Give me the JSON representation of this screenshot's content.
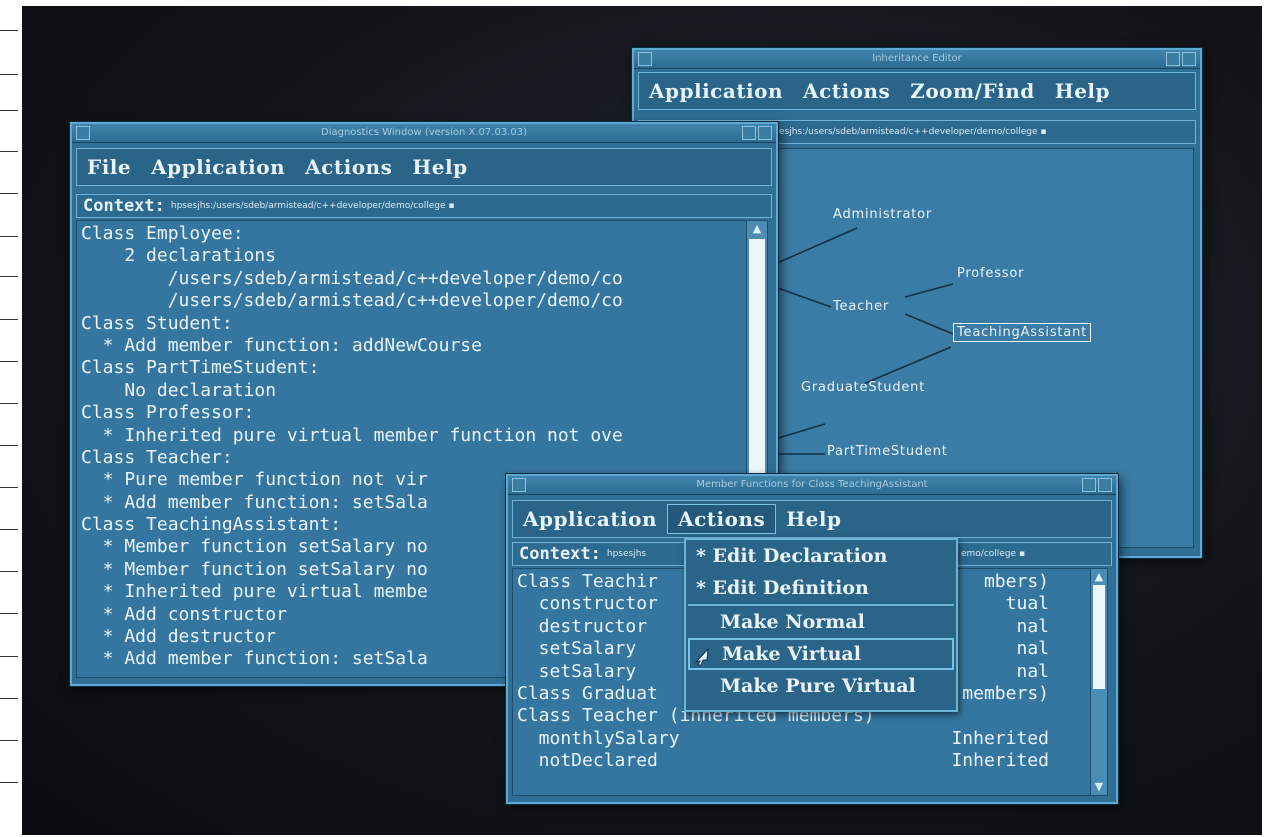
{
  "diagnostics": {
    "title": "Diagnostics Window (version X.07.03.03)",
    "menu": [
      "File",
      "Application",
      "Actions",
      "Help"
    ],
    "context_label": "Context:",
    "context_path": "hpsesjhs:/users/sdeb/armistead/c++developer/demo/college ▪",
    "lines": [
      "Class Employee:",
      "    2 declarations",
      "        /users/sdeb/armistead/c++developer/demo/co",
      "        /users/sdeb/armistead/c++developer/demo/co",
      "Class Student:",
      "  * Add member function: addNewCourse",
      "Class PartTimeStudent:",
      "    No declaration",
      "Class Professor:",
      "  * Inherited pure virtual member function not ove",
      "Class Teacher:",
      "  * Pure member function not vir",
      "  * Add member function: setSala",
      "Class TeachingAssistant:",
      "  * Member function setSalary no",
      "  * Member function setSalary no",
      "  * Inherited pure virtual membe",
      "  * Add constructor",
      "  * Add destructor",
      "  * Add member function: setSala"
    ]
  },
  "inheritance": {
    "title": "Inheritance Editor",
    "menu": [
      "Application",
      "Actions",
      "Zoom/Find",
      "Help"
    ],
    "context_path": "esjhs:/users/sdeb/armistead/c++developer/demo/college ▪",
    "nodes": [
      "Administrator",
      "Professor",
      "Teacher",
      "TeachingAssistant",
      "GraduateStudent",
      "PartTimeStudent"
    ]
  },
  "member_functions": {
    "title": "Member Functions for Class TeachingAssistant",
    "menu": [
      "Application",
      "Actions",
      "Help"
    ],
    "context_label": "Context:",
    "context_path_left": "hpsesjhs",
    "context_path_right": "emo/college ▪",
    "lines": [
      "Class Teachir",
      "  constructor",
      "  destructor",
      "  setSalary",
      "  setSalary",
      "Class Graduat",
      "Class Teacher (inherited members)",
      "  monthlySalary",
      "  notDeclared"
    ],
    "right_col": [
      "mbers)",
      "tual",
      "nal",
      "nal",
      "nal",
      "members)",
      "",
      "Inherited",
      "Inherited"
    ]
  },
  "actions_menu": {
    "items": [
      "* Edit Declaration",
      "* Edit Definition",
      "Make Normal",
      "Make Virtual",
      "Make Pure Virtual"
    ]
  }
}
